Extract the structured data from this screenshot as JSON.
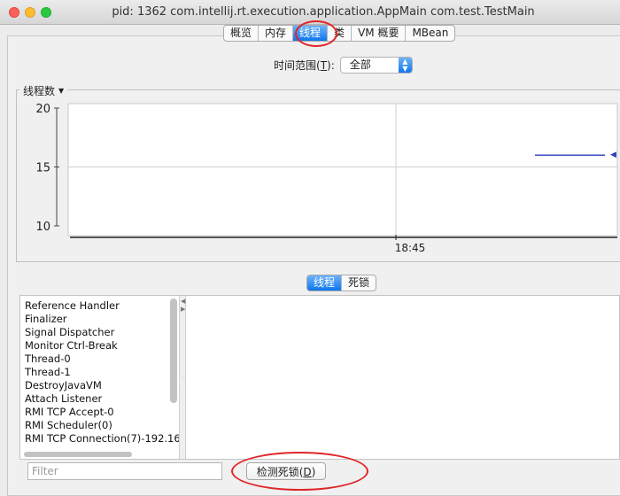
{
  "window": {
    "title": "pid: 1362 com.intellij.rt.execution.application.AppMain com.test.TestMain"
  },
  "top_tabs": [
    {
      "label": "概览",
      "active": false
    },
    {
      "label": "内存",
      "active": false
    },
    {
      "label": "线程",
      "active": true
    },
    {
      "label": "类",
      "active": false
    },
    {
      "label": "VM 概要",
      "active": false
    },
    {
      "label": "MBean",
      "active": false
    }
  ],
  "time_range": {
    "label": "时间范围(T):",
    "label_prefix": "时间范围(",
    "label_mnemonic": "T",
    "label_suffix": "):",
    "selected": "全部"
  },
  "chart_panel": {
    "legend_label": "线程数"
  },
  "chart_data": {
    "type": "line",
    "ylim": [
      10,
      20
    ],
    "yticks": [
      10,
      15,
      20
    ],
    "xticks": [
      "18:45"
    ],
    "series": [
      {
        "values": [
          16,
          16
        ],
        "color": "#2b3dbd"
      }
    ],
    "grid": true
  },
  "bottom_tabs": [
    {
      "label": "线程",
      "active": true
    },
    {
      "label": "死锁",
      "active": false
    }
  ],
  "threads": [
    "Reference Handler",
    "Finalizer",
    "Signal Dispatcher",
    "Monitor Ctrl-Break",
    "Thread-0",
    "Thread-1",
    "DestroyJavaVM",
    "Attach Listener",
    "RMI TCP Accept-0",
    "RMI Scheduler(0)",
    "RMI TCP Connection(7)-192.16"
  ],
  "filter": {
    "placeholder": "Filter"
  },
  "detect_button": {
    "label": "检测死锁(D)",
    "text": "检测死锁(",
    "mnemonic": "D",
    "suffix": ")"
  },
  "colors": {
    "active_tab": "#1a7ff0",
    "annotation_circle": "#e0262a",
    "series_line": "#2b3dbd"
  }
}
